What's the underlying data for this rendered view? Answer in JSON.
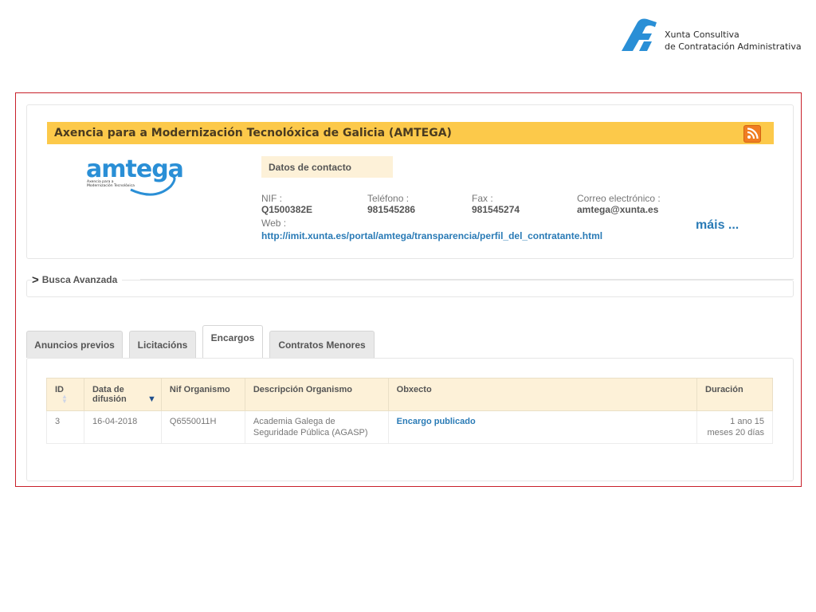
{
  "header": {
    "org_line1": "Xunta Consultiva",
    "org_line2": "de Contratación Administrativa",
    "logo_color": "#2a8fd6"
  },
  "profile": {
    "title": "Axencia para a Modernización Tecnolóxica de Galicia (AMTEGA)",
    "title_bar_color": "#fcc94a",
    "rss_icon": "rss-icon",
    "logo_text": "amtega",
    "logo_subtext_1": "Axencia para a",
    "logo_subtext_2": "Modernización Tecnolóxica",
    "contact_heading": "Datos de contacto",
    "nif_label": "NIF :",
    "nif_value": "Q1500382E",
    "phone_label": "Teléfono :",
    "phone_value": "981545286",
    "fax_label": "Fax :",
    "fax_value": "981545274",
    "email_label": "Correo electrónico :",
    "email_value": "amtega@xunta.es",
    "web_label": "Web :",
    "web_value": "http://imit.xunta.es/portal/amtega/transparencia/perfil_del_contratante.html",
    "more_label": "máis ..."
  },
  "search": {
    "label": "Busca Avanzada"
  },
  "tabs": [
    {
      "label": "Anuncios previos"
    },
    {
      "label": "Licitacións"
    },
    {
      "label": "Encargos"
    },
    {
      "label": "Contratos Menores"
    }
  ],
  "table": {
    "columns": [
      "ID",
      "Data de difusión",
      "Nif Organismo",
      "Descripción Organismo",
      "Obxecto",
      "Duración"
    ],
    "rows": [
      {
        "id": "3",
        "date": "16-04-2018",
        "nif": "Q6550011H",
        "description": "Academia Galega de Seguridade Pública (AGASP)",
        "object": "Encargo publicado",
        "duration": "1 ano 15 meses 20 días"
      }
    ]
  },
  "colors": {
    "frame_border": "#c8202a",
    "link": "#2a7bb6",
    "header_row": "#fdf1d8",
    "rss": "#f07d22"
  }
}
